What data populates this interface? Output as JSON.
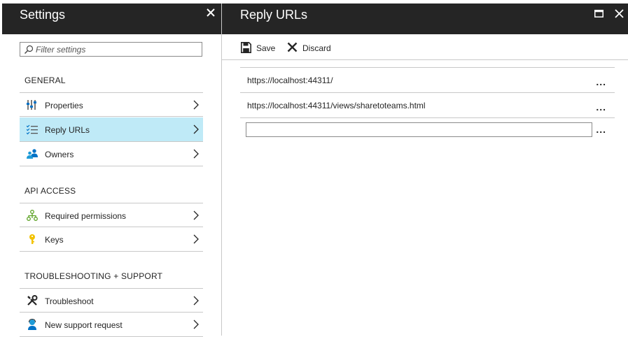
{
  "settings": {
    "title": "Settings",
    "filter_placeholder": "Filter settings",
    "sections": [
      {
        "heading": "GENERAL",
        "items": [
          {
            "label": "Properties",
            "icon": "properties-icon"
          },
          {
            "label": "Reply URLs",
            "icon": "list-check-icon",
            "selected": true
          },
          {
            "label": "Owners",
            "icon": "people-icon"
          }
        ]
      },
      {
        "heading": "API ACCESS",
        "items": [
          {
            "label": "Required permissions",
            "icon": "permissions-tree-icon"
          },
          {
            "label": "Keys",
            "icon": "key-icon"
          }
        ]
      },
      {
        "heading": "TROUBLESHOOTING + SUPPORT",
        "items": [
          {
            "label": "Troubleshoot",
            "icon": "wrench-icon"
          },
          {
            "label": "New support request",
            "icon": "support-person-icon"
          }
        ]
      }
    ]
  },
  "reply_urls": {
    "title": "Reply URLs",
    "toolbar": {
      "save_label": "Save",
      "discard_label": "Discard"
    },
    "urls": [
      "https://localhost:44311/",
      "https://localhost:44311/views/sharetoteams.html"
    ],
    "new_url_value": "",
    "more_label": "..."
  },
  "colors": {
    "header": "#252525",
    "selected": "#bfeaf7",
    "accent": "#0072c6"
  }
}
